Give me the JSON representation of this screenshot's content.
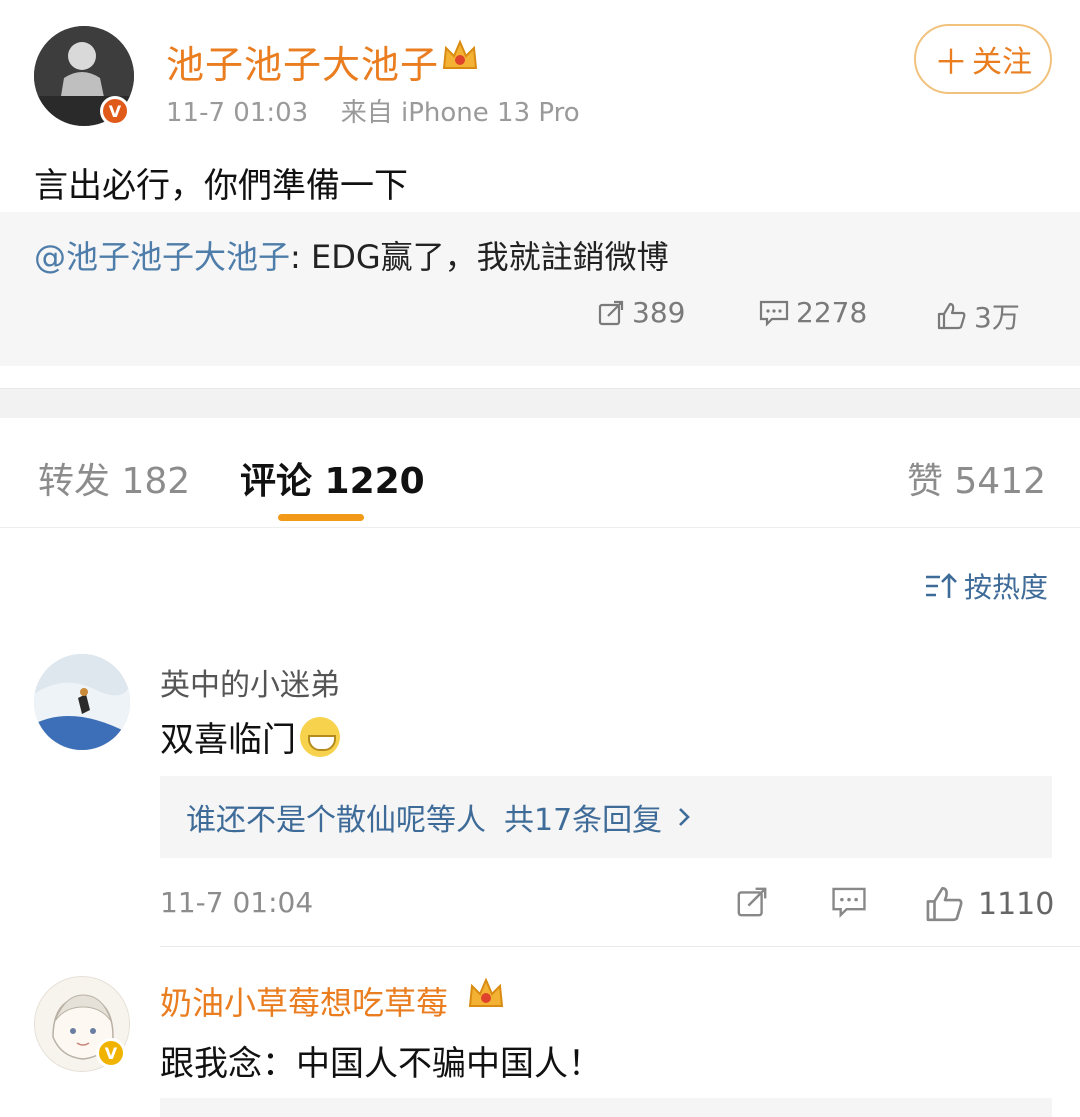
{
  "post": {
    "author_name": "池子池子大池子",
    "time": "11-7 01:03",
    "source": "来自 iPhone 13 Pro",
    "follow_label": "关注",
    "text": "言出必行，你們準備一下",
    "quoted": {
      "mention": "@池子池子大池子",
      "text": ": EDG赢了，我就註銷微博",
      "reposts": "389",
      "comments": "2278",
      "likes": "3万"
    }
  },
  "tabs": {
    "reposts": "转发 182",
    "comments": "评论 1220",
    "likes": "赞 5412"
  },
  "sort_label": "按热度",
  "comments": [
    {
      "name": "英中的小迷弟",
      "text": "双喜临门",
      "replies_summary": "谁还不是个散仙呢等人",
      "replies_count": "共17条回复",
      "time": "11-7 01:04",
      "like_count": "1110"
    },
    {
      "name": "奶油小草莓想吃草莓",
      "text": "跟我念：中国人不骗中国人！"
    }
  ],
  "colors": {
    "brand_orange": "#e97d1f",
    "link_blue": "#4f7daa",
    "tab_indicator": "#f29a18",
    "verified_badge": "#e05a1a",
    "gold_badge": "#f0b400"
  },
  "icons": [
    "crown-icon",
    "verified-badge-icon",
    "plus-icon",
    "repost-icon",
    "comment-icon",
    "like-icon",
    "sort-icon",
    "chevron-right-icon",
    "grin-emoji-icon"
  ]
}
